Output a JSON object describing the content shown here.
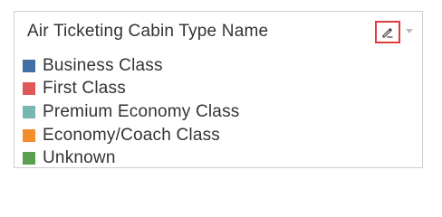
{
  "legend": {
    "title": "Air Ticketing Cabin Type Name",
    "edit_icon": "pencil-edit-icon",
    "menu_icon": "chevron-down-icon",
    "items": [
      {
        "label": "Business Class",
        "color": "#3f6fa3"
      },
      {
        "label": "First Class",
        "color": "#e15759"
      },
      {
        "label": "Premium Economy Class",
        "color": "#76b7b2"
      },
      {
        "label": "Economy/Coach Class",
        "color": "#f28e2b"
      },
      {
        "label": "Unknown",
        "color": "#59a14f"
      }
    ]
  }
}
